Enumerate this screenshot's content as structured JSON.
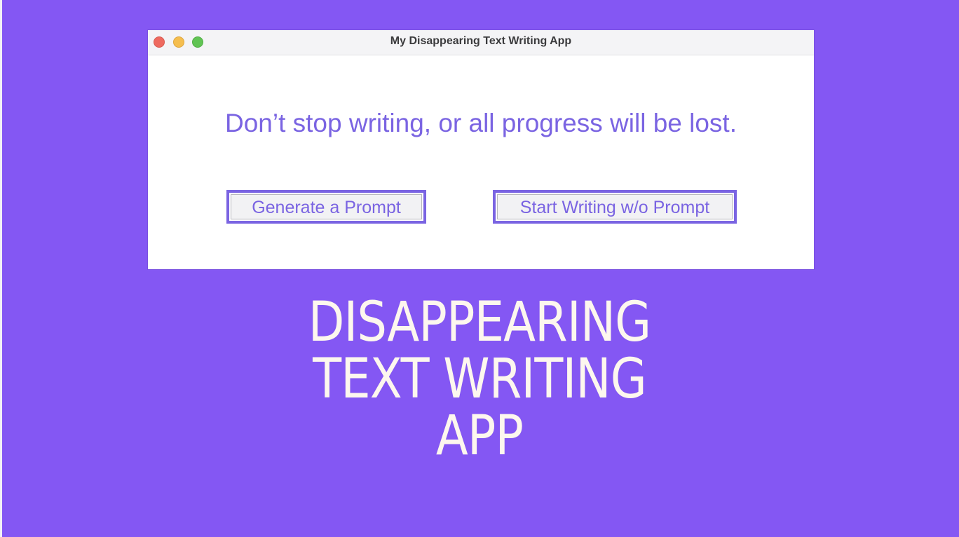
{
  "window": {
    "title": "My Disappearing Text Writing App"
  },
  "main": {
    "headline": "Don’t stop writing, or all progress will be lost.",
    "buttons": {
      "generate_label": "Generate a Prompt",
      "start_label": "Start Writing w/o Prompt"
    }
  },
  "banner": {
    "lines": [
      "DISAPPEARING",
      "TEXT WRITING",
      "APP"
    ]
  },
  "colors": {
    "background": "#8457f3",
    "accent": "#7a64e2",
    "banner_text": "#fdf7ee"
  }
}
